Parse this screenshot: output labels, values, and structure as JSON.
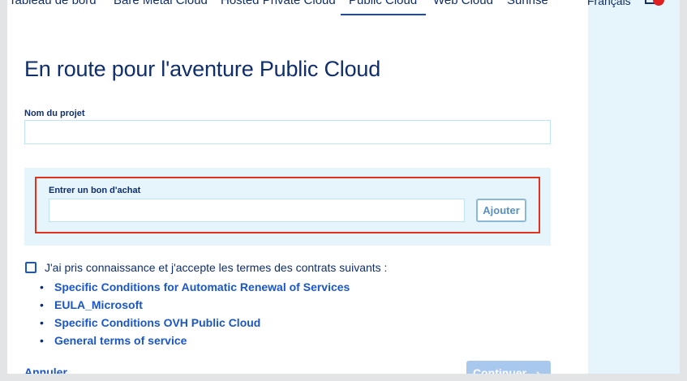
{
  "nav": {
    "items": [
      {
        "label": "Tableau de bord"
      },
      {
        "label": "Bare Metal Cloud"
      },
      {
        "label": "Hosted Private Cloud"
      },
      {
        "label": "Public Cloud"
      },
      {
        "label": "Web Cloud"
      },
      {
        "label": "Sunrise"
      }
    ],
    "active": "Public Cloud",
    "language": "Français",
    "notification_icon": "bell-icon"
  },
  "page": {
    "title": "En route pour l'aventure Public Cloud"
  },
  "project": {
    "label": "Nom du projet",
    "value": ""
  },
  "voucher": {
    "label": "Entrer un bon d'achat",
    "value": "",
    "add_label": "Ajouter"
  },
  "terms": {
    "checked": false,
    "text": "J'ai pris connaissance et j'accepte les termes des contrats suivants :",
    "contracts": [
      {
        "label": "Specific Conditions for Automatic Renewal of Services"
      },
      {
        "label": "EULA_Microsoft"
      },
      {
        "label": "Specific Conditions OVH Public Cloud"
      },
      {
        "label": "General terms of service"
      }
    ]
  },
  "actions": {
    "cancel_label": "Annuler",
    "continue_label": "Continuer",
    "continue_icon": "chevron-right-icon"
  },
  "colors": {
    "primary": "#1a56c9",
    "title": "#0f2e6b",
    "highlight": "#e2311d",
    "panel": "#e6f4fb"
  }
}
